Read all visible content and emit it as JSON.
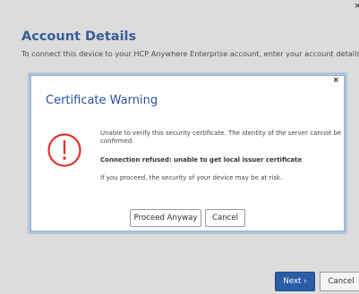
{
  "window": {
    "close_glyph": "×"
  },
  "page": {
    "title": "Account Details",
    "subtitle": "To connect this device to your HCP Anywhere Enterprise account, enter your account details."
  },
  "footer": {
    "next_label": "Next ›",
    "cancel_label": "Cancel"
  },
  "dialog": {
    "close_glyph": "×",
    "title": "Certificate Warning",
    "icon": "exclamation-circle-icon",
    "message_line1": "Unable to verify this security certificate. The identity of the server cannot be confirmed.",
    "message_line2": "Connection refused: unable to get local issuer certificate",
    "message_line3": "If you proceed, the security of your device may be at risk.",
    "proceed_label": "Proceed Anyway",
    "cancel_label": "Cancel"
  },
  "colors": {
    "accent": "#245199",
    "primary_button": "#2b5da6",
    "warning": "#e0312b",
    "dialog_border": "#8fb1d8"
  }
}
